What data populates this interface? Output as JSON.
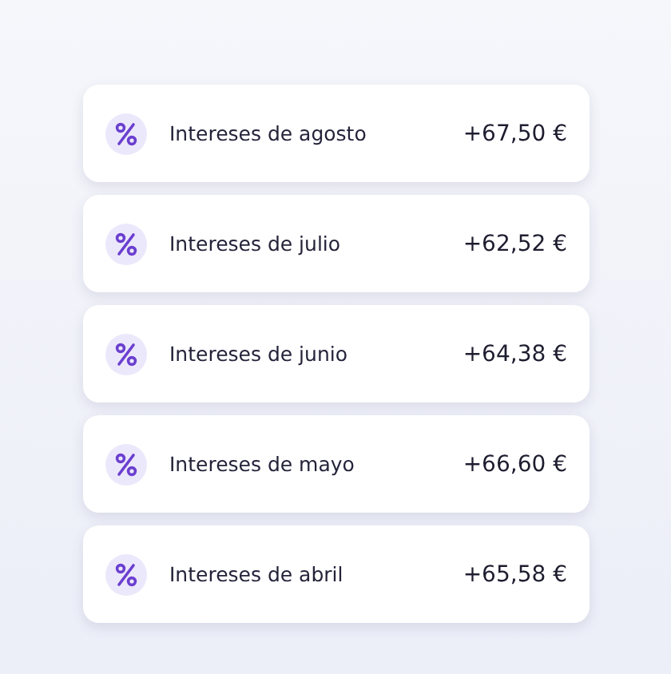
{
  "transactions": [
    {
      "label": "Intereses de agosto",
      "amount": "+67,50 €"
    },
    {
      "label": "Intereses de julio",
      "amount": "+62,52 €"
    },
    {
      "label": "Intereses de junio",
      "amount": "+64,38 €"
    },
    {
      "label": "Intereses de mayo",
      "amount": "+66,60 €"
    },
    {
      "label": "Intereses de abril",
      "amount": "+65,58 €"
    }
  ]
}
